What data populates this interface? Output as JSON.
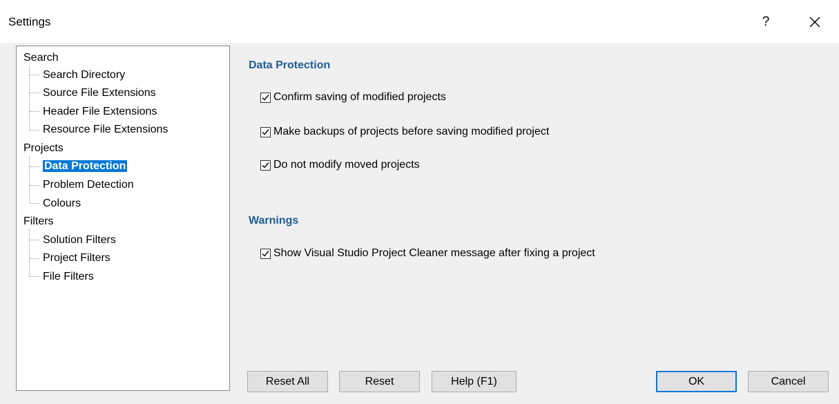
{
  "window": {
    "title": "Settings",
    "help_glyph": "?",
    "close_icon": "close-icon"
  },
  "tree": {
    "groups": [
      {
        "label": "Search",
        "children": [
          "Search Directory",
          "Source File Extensions",
          "Header File Extensions",
          "Resource File Extensions"
        ]
      },
      {
        "label": "Projects",
        "children": [
          "Data Protection",
          "Problem Detection",
          "Colours"
        ]
      },
      {
        "label": "Filters",
        "children": [
          "Solution Filters",
          "Project Filters",
          "File Filters"
        ]
      }
    ],
    "selected": "Data Protection"
  },
  "panel": {
    "data_protection_title": "Data Protection",
    "options": [
      {
        "label": "Confirm saving of modified projects",
        "checked": true
      },
      {
        "label": "Make backups of projects before saving modified project",
        "checked": true
      },
      {
        "label": "Do not modify moved projects",
        "checked": true
      }
    ],
    "warnings_title": "Warnings",
    "warning_options": [
      {
        "label": "Show Visual Studio Project Cleaner message after fixing a project",
        "checked": true
      }
    ]
  },
  "buttons": {
    "reset_all": "Reset All",
    "reset": "Reset",
    "help": "Help (F1)",
    "ok": "OK",
    "cancel": "Cancel"
  },
  "colors": {
    "accent": "#0078d7",
    "section_title": "#1f5d95"
  }
}
